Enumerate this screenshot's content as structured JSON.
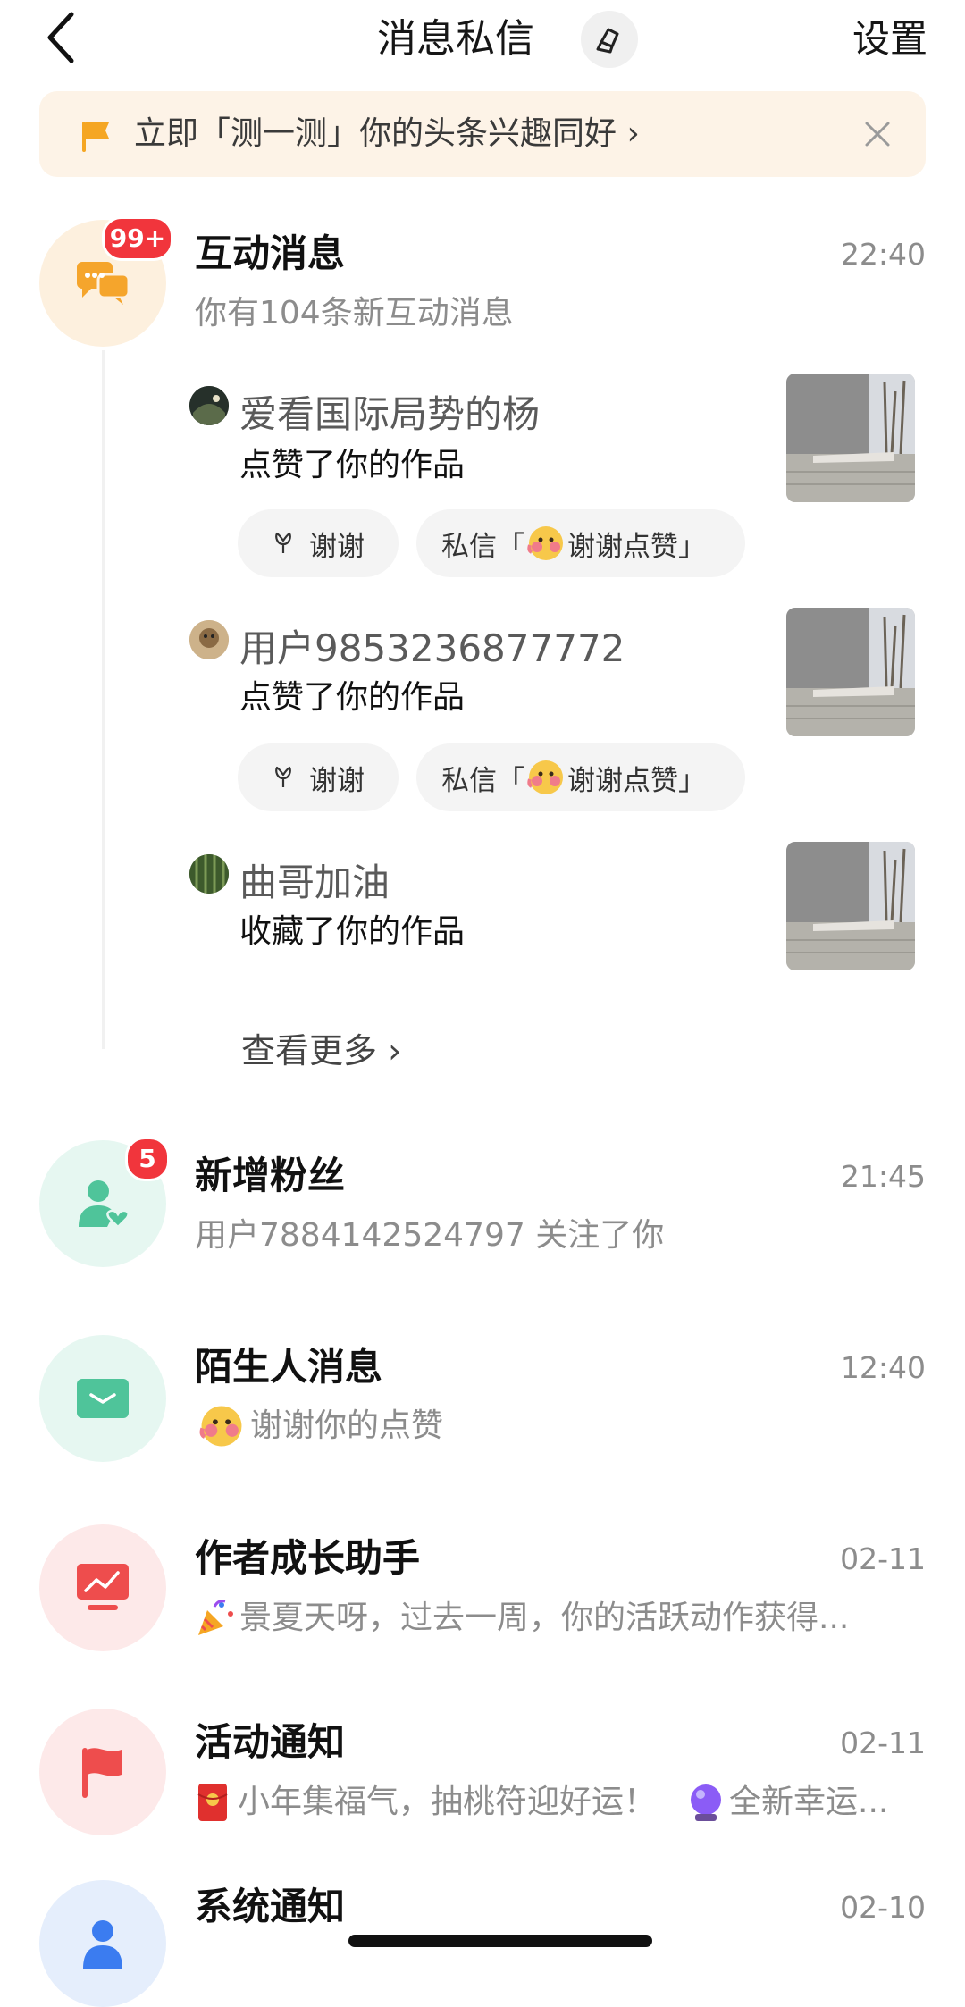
{
  "header": {
    "title": "消息私信",
    "settings_label": "设置",
    "back_icon": "back-chevron-icon",
    "clean_icon": "broom-icon"
  },
  "banner": {
    "text": "立即「测一测」你的头条兴趣同好 ›",
    "flag_color": "#f5a623"
  },
  "interaction": {
    "title": "互动消息",
    "badge": "99+",
    "time": "22:40",
    "subtitle": "你有104条新互动消息",
    "items": [
      {
        "name": "爱看国际局势的杨",
        "action": "点赞了你的作品",
        "thanks_label": "谢谢",
        "dm_prefix": "私信「",
        "dm_text": "谢谢点赞」"
      },
      {
        "name": "用户9853236877772",
        "action": "点赞了你的作品",
        "thanks_label": "谢谢",
        "dm_prefix": "私信「",
        "dm_text": "谢谢点赞」"
      },
      {
        "name": "曲哥加油",
        "action": "收藏了你的作品"
      }
    ],
    "see_more": "查看更多 ›"
  },
  "followers": {
    "title": "新增粉丝",
    "badge": "5",
    "time": "21:45",
    "subtitle": "用户7884142524797 关注了你"
  },
  "strangers": {
    "title": "陌生人消息",
    "time": "12:40",
    "subtitle": "谢谢你的点赞"
  },
  "author_growth": {
    "title": "作者成长助手",
    "time": "02-11",
    "subtitle": "景夏天呀，过去一周，你的活跃动作获得..."
  },
  "events": {
    "title": "活动通知",
    "time": "02-11",
    "subtitle": "小年集福气，抽桃符迎好运！",
    "subtitle2": "全新幸运..."
  },
  "system": {
    "title": "系统通知",
    "time": "02-10"
  },
  "colors": {
    "interaction_bg": "#fdf0de",
    "interaction_icon": "#f5a52c",
    "followers_bg": "#e6f7f1",
    "followers_icon": "#4fc49a",
    "strangers_bg": "#e6f7f1",
    "strangers_icon": "#4fc49a",
    "growth_bg": "#fde9e9",
    "growth_icon": "#ee4d4d",
    "events_bg": "#fde9e9",
    "events_icon": "#ee4d4d",
    "system_bg": "#e5eefc",
    "system_icon": "#3b7cf0"
  }
}
